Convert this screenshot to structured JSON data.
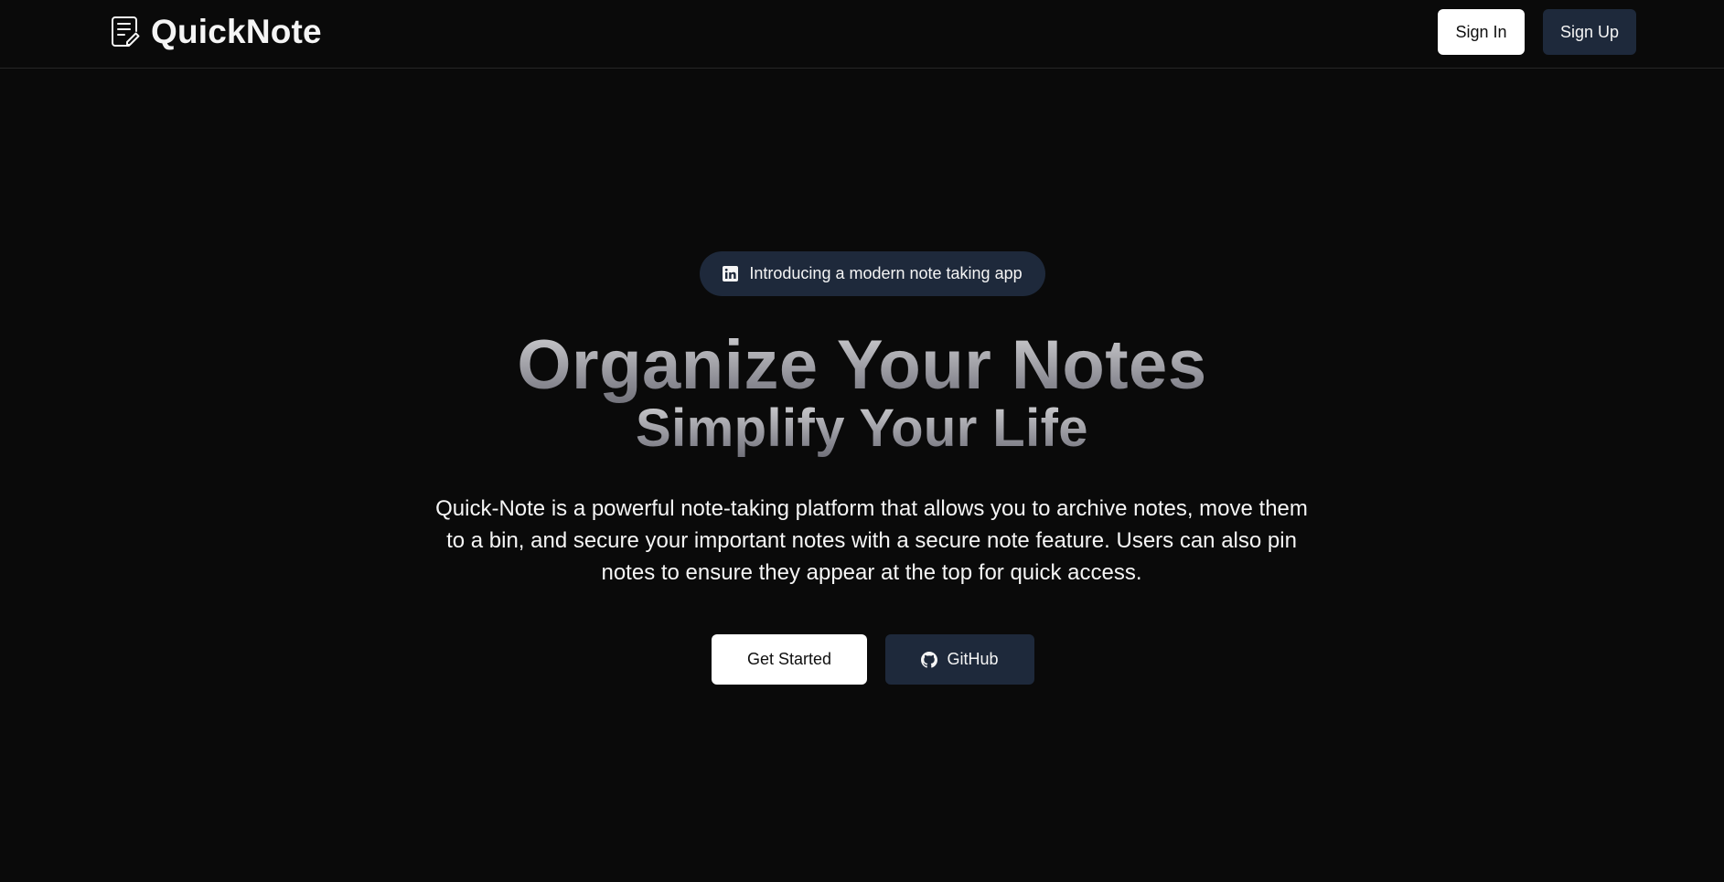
{
  "header": {
    "brand_icon": "note-edit-icon",
    "brand_name": "QuickNote",
    "sign_in_label": "Sign In",
    "sign_up_label": "Sign Up"
  },
  "hero": {
    "badge": {
      "icon": "linkedin-icon",
      "text": "Introducing a modern note taking app"
    },
    "title_line1": "Organize Your Notes",
    "title_line2": "Simplify Your Life",
    "description": "Quick-Note is a powerful note-taking platform that allows you to archive notes, move them to a bin, and secure your important notes with a secure note feature. Users can also pin notes to ensure they appear at the top for quick access.",
    "get_started_label": "Get Started",
    "github_icon": "github-icon",
    "github_label": "GitHub"
  },
  "colors": {
    "background": "#0a0a0a",
    "badge_bg": "#1e293b",
    "dark_button_bg": "#1e293b",
    "light_button_bg": "#ffffff",
    "text": "#f5f5f5"
  }
}
